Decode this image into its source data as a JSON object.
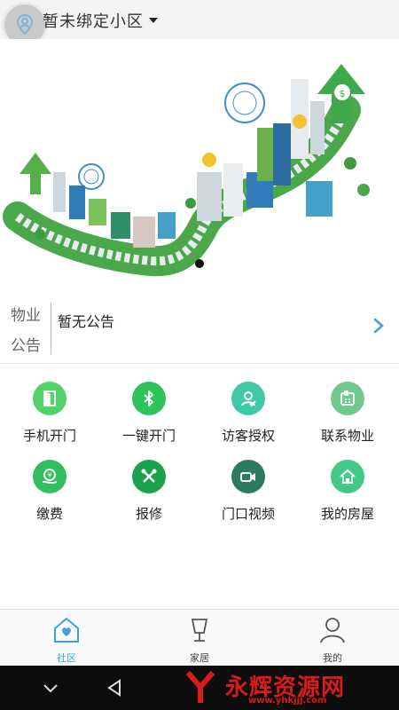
{
  "header": {
    "location_title": "暂未绑定小区"
  },
  "notice": {
    "label_line1": "物业",
    "label_line2": "公告",
    "text": "暂无公告"
  },
  "services": [
    {
      "label": "手机开门",
      "icon": "door-icon",
      "color": "#52d36a"
    },
    {
      "label": "一键开门",
      "icon": "bluetooth-icon",
      "color": "#2fc25b"
    },
    {
      "label": "访客授权",
      "icon": "visitor-icon",
      "color": "#3ec9a7"
    },
    {
      "label": "联系物业",
      "icon": "phone-icon",
      "color": "#6fc98e"
    },
    {
      "label": "缴费",
      "icon": "payment-icon",
      "color": "#2fbf5e"
    },
    {
      "label": "报修",
      "icon": "repair-tools-icon",
      "color": "#1aa34a"
    },
    {
      "label": "门口视频",
      "icon": "video-camera-icon",
      "color": "#2d7a62"
    },
    {
      "label": "我的房屋",
      "icon": "house-icon",
      "color": "#42c98a"
    }
  ],
  "tabbar": [
    {
      "label": "社区",
      "active": true
    },
    {
      "label": "家居",
      "active": false
    },
    {
      "label": "我的",
      "active": false
    }
  ],
  "watermark": {
    "text": "永辉资源网",
    "url": "www.yhkjjj.com"
  },
  "colors": {
    "accent": "#3ea2d6",
    "green": "#2fc25b"
  }
}
